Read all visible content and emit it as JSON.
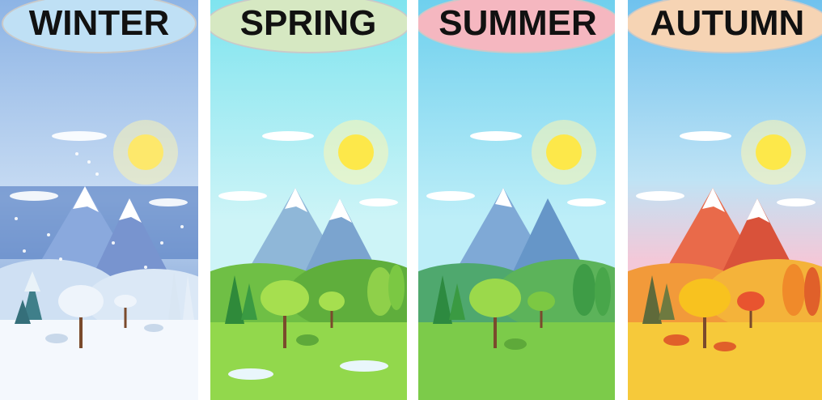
{
  "seasons": [
    {
      "name": "WINTER",
      "label_color": "#bfe0f5",
      "sky_top": "#8fb6e6",
      "sky_bottom": "#cfe3f6",
      "mountain": "#9dbbe3",
      "ground": "#f3f8fd",
      "tree": "#eaf2f8"
    },
    {
      "name": "SPRING",
      "label_color": "#d6e8c2",
      "sky_top": "#7fe3ee",
      "sky_bottom": "#c6f2f6",
      "mountain": "#8fb8d9",
      "ground": "#8bd14d",
      "tree": "#9bd94b"
    },
    {
      "name": "SUMMER",
      "label_color": "#f5b7c0",
      "sky_top": "#6fd0ee",
      "sky_bottom": "#b8ecf7",
      "mountain": "#7fb0d6",
      "ground": "#7dc96a",
      "tree": "#8fd04a"
    },
    {
      "name": "AUTUMN",
      "label_color": "#f6d4b4",
      "sky_top": "#6fc2ee",
      "sky_bottom": "#f3c8d8",
      "mountain": "#e96a4a",
      "ground": "#f4c232",
      "tree": "#f5c11f"
    }
  ]
}
